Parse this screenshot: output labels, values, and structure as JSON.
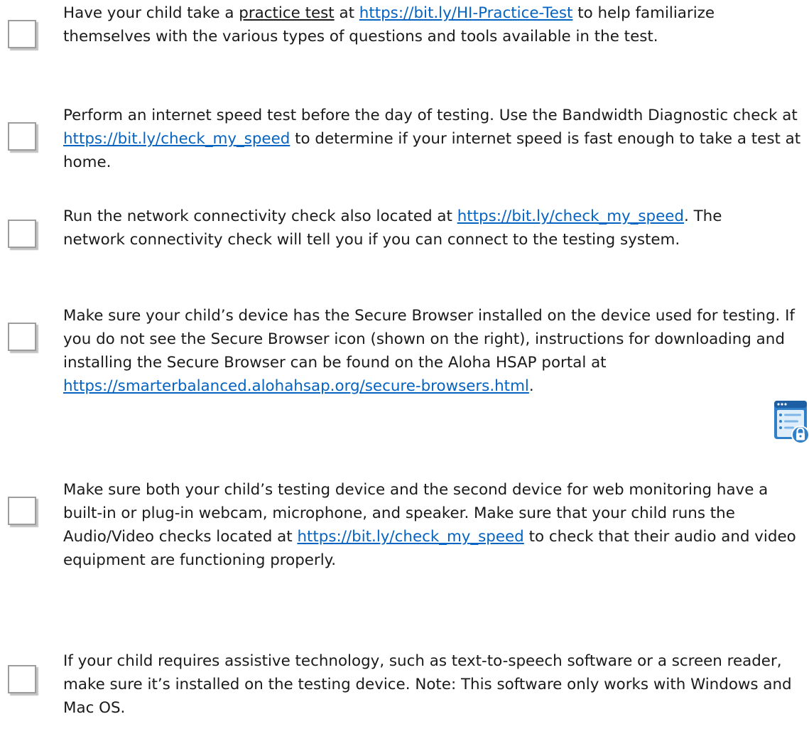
{
  "items": [
    {
      "segments": [
        {
          "text": "Have your child take a ",
          "style": "plain"
        },
        {
          "text": "practice test",
          "style": "underline"
        },
        {
          "text": " at ",
          "style": "plain"
        },
        {
          "text": "https://bit.ly/HI-Practice-Test",
          "style": "link"
        },
        {
          "text": " to help familiarize themselves with the various types of questions and tools available in the test.",
          "style": "plain"
        }
      ]
    },
    {
      "segments": [
        {
          "text": "Perform an internet speed test before the day of testing. Use the Bandwidth Diagnostic check at ",
          "style": "plain"
        },
        {
          "text": "https://bit.ly/check_my_speed",
          "style": "link"
        },
        {
          "text": " to determine if your internet speed is fast enough to take a test at home.",
          "style": "plain"
        }
      ]
    },
    {
      "segments": [
        {
          "text": "Run the network connectivity check also located at ",
          "style": "plain"
        },
        {
          "text": "https://bit.ly/check_my_speed",
          "style": "link"
        },
        {
          "text": ". The network connectivity check will tell you if you can connect to the testing system.",
          "style": "plain"
        }
      ]
    },
    {
      "segments": [
        {
          "text": "Make sure your child’s device has the Secure Browser installed on the device used for testing. If you do not see the Secure Browser icon (shown on the right), instructions for downloading and installing the Secure Browser can be found on the Aloha HSAP portal at ",
          "style": "plain"
        },
        {
          "text": "https://smarterbalanced.alohahsap.org/secure-browsers.html",
          "style": "link"
        },
        {
          "text": ".",
          "style": "plain"
        }
      ]
    },
    {
      "segments": [
        {
          "text": "Make sure both your child’s testing device and the second device for web monitoring have a built-in or plug-in webcam, microphone, and speaker. Make sure that your child runs the Audio/Video checks located at ",
          "style": "plain"
        },
        {
          "text": "https://bit.ly/check_my_speed",
          "style": "link"
        },
        {
          "text": " to check that their audio and video equipment are functioning properly.",
          "style": "plain"
        }
      ]
    },
    {
      "segments": [
        {
          "text": "If your child requires assistive technology, such as text-to-speech software or a screen reader, make sure it’s installed on the testing device. Note: This software only works with Windows and Mac OS.",
          "style": "plain"
        }
      ]
    }
  ],
  "icons": {
    "secure_browser": "secure-browser-icon",
    "checkbox": "checkbox-icon"
  },
  "colors": {
    "link": "#0563c1",
    "text": "#1a1a1a",
    "checkbox_border": "#9d9d9d",
    "icon_blue": "#2f80c9"
  }
}
